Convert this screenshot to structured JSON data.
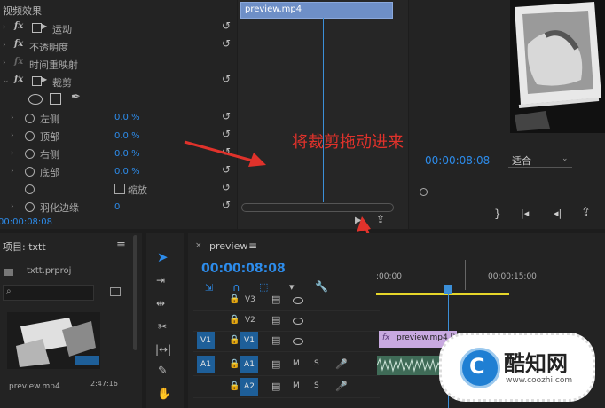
{
  "effects_panel": {
    "header": "视频效果",
    "rows": [
      {
        "label": "运动"
      },
      {
        "label": "不透明度"
      },
      {
        "label": "时间重映射"
      },
      {
        "label": "裁剪"
      }
    ],
    "crop_params": [
      {
        "label": "左侧",
        "value": "0.0 %"
      },
      {
        "label": "顶部",
        "value": "0.0 %"
      },
      {
        "label": "右侧",
        "value": "0.0 %"
      },
      {
        "label": "底部",
        "value": "0.0 %"
      },
      {
        "label": "缩放",
        "value": ""
      },
      {
        "label": "羽化边缘",
        "value": "0"
      }
    ],
    "timecode": "00:00:08:08"
  },
  "source_timeline": {
    "clip_name": "preview.mp4"
  },
  "annotation": {
    "text": "将裁剪拖动进来",
    "color": "#e0322b"
  },
  "program_monitor": {
    "timecode": "00:00:08:08",
    "fit_label": "适合"
  },
  "project_panel": {
    "title": "项目: txtt",
    "menu_icon": "≡",
    "file_name": "txtt.prproj",
    "thumb_name": "preview.mp4",
    "thumb_duration": "2:47:16"
  },
  "sequence_panel": {
    "tab_label": "preview",
    "menu_icon": "≡",
    "timecode": "00:00:08:08",
    "ruler_labels": [
      ":00:00",
      "00:00:15:00"
    ],
    "tracks": [
      {
        "name": "V3",
        "target": ""
      },
      {
        "name": "V2",
        "target": ""
      },
      {
        "name": "V1",
        "target": "V1"
      },
      {
        "name": "A1",
        "target": "A1"
      },
      {
        "name": "A2",
        "target": ""
      }
    ],
    "clip_label": "preview.mp4 [V]"
  },
  "watermark": {
    "brand": "酷知网",
    "url": "www.coozhi.com"
  },
  "colors": {
    "accent_blue": "#2d8ceb",
    "playhead": "#3b8fd8",
    "work_area": "#e6d62a"
  }
}
